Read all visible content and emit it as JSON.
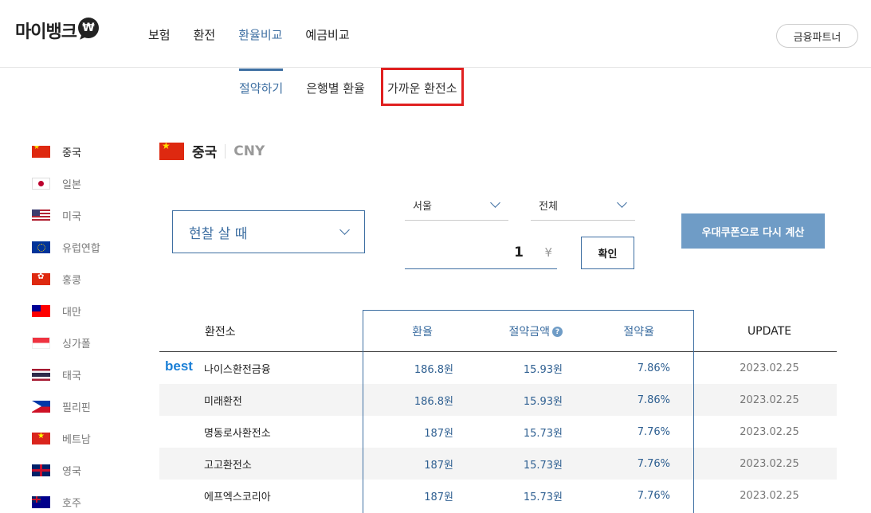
{
  "header": {
    "logo_text": "마이뱅크",
    "logo_symbol": "₩",
    "nav": [
      "보험",
      "환전",
      "환율비교",
      "예금비교"
    ],
    "nav_active_index": 2,
    "partner_button": "금융파트너"
  },
  "subnav": {
    "items": [
      "절약하기",
      "은행별 환율",
      "가까운 환전소"
    ],
    "active_index": 0,
    "highlighted_index": 2
  },
  "countries": [
    "중국",
    "일본",
    "미국",
    "유럽연합",
    "홍콩",
    "대만",
    "싱가폴",
    "태국",
    "필리핀",
    "베트남",
    "영국",
    "호주"
  ],
  "main": {
    "country": "중국",
    "currency_code": "CNY"
  },
  "controls": {
    "type_select": "현찰 살 때",
    "region_select": "서울",
    "scope_select": "전체",
    "amount": "1",
    "amount_unit": "¥",
    "confirm_button": "확인",
    "coupon_button": "우대쿠폰으로 다시 계산"
  },
  "table": {
    "headers": {
      "name": "환전소",
      "rate": "환율",
      "save_amount": "절약금액",
      "save_ratio": "절약율",
      "update": "UPDATE"
    },
    "best_label": "best",
    "rows": [
      {
        "name": "나이스환전금융",
        "rate": "186.8원",
        "save_amount": "15.93원",
        "save_ratio": "7.86%",
        "update": "2023.02.25"
      },
      {
        "name": "미래환전",
        "rate": "186.8원",
        "save_amount": "15.93원",
        "save_ratio": "7.86%",
        "update": "2023.02.25"
      },
      {
        "name": "명동로사환전소",
        "rate": "187원",
        "save_amount": "15.73원",
        "save_ratio": "7.76%",
        "update": "2023.02.25"
      },
      {
        "name": "고고환전소",
        "rate": "187원",
        "save_amount": "15.73원",
        "save_ratio": "7.76%",
        "update": "2023.02.25"
      },
      {
        "name": "에프엑스코리아",
        "rate": "187원",
        "save_amount": "15.73원",
        "save_ratio": "7.76%",
        "update": "2023.02.25"
      }
    ]
  },
  "colors": {
    "accent": "#3e6fa2",
    "coupon_button": "#6f9cc6",
    "highlight_outline": "#e02020",
    "best": "#1a7fd6"
  }
}
